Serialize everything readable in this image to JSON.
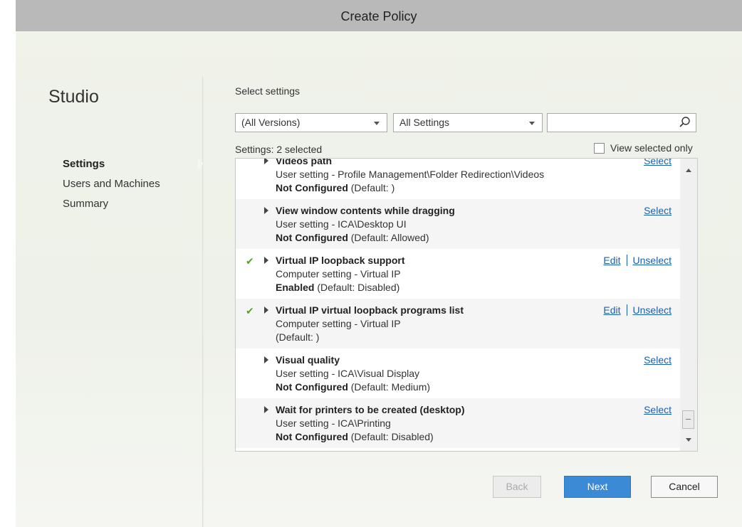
{
  "window": {
    "title": "Create Policy"
  },
  "sidebar": {
    "app_name": "Studio",
    "items": [
      {
        "label": "Settings",
        "active": true
      },
      {
        "label": "Users and Machines",
        "active": false
      },
      {
        "label": "Summary",
        "active": false
      }
    ]
  },
  "main": {
    "heading": "Select settings",
    "version_filter": {
      "value": "(All Versions)"
    },
    "category_filter": {
      "value": "All Settings"
    },
    "search": {
      "value": "",
      "placeholder": ""
    },
    "settings_count": "Settings: 2 selected",
    "view_selected_only": {
      "label": "View selected only",
      "checked": false
    },
    "settings": [
      {
        "name": "Videos path",
        "category": "User setting - Profile Management\\Folder Redirection\\Videos",
        "state": "Not Configured",
        "default": " (Default: )",
        "selected": false,
        "actions": {
          "select": "Select"
        }
      },
      {
        "name": "View window contents while dragging",
        "category": "User setting - ICA\\Desktop UI",
        "state": "Not Configured",
        "default": " (Default: Allowed)",
        "selected": false,
        "actions": {
          "select": "Select"
        }
      },
      {
        "name": "Virtual IP loopback support",
        "category": "Computer setting - Virtual IP",
        "state": "Enabled",
        "default": " (Default: Disabled)",
        "selected": true,
        "actions": {
          "edit": "Edit",
          "unselect": "Unselect"
        }
      },
      {
        "name": "Virtual IP virtual loopback programs list",
        "category": "Computer setting - Virtual IP",
        "state": "",
        "default": " (Default: )",
        "selected": true,
        "actions": {
          "edit": "Edit",
          "unselect": "Unselect"
        }
      },
      {
        "name": "Visual quality",
        "category": "User setting - ICA\\Visual Display",
        "state": "Not Configured",
        "default": " (Default: Medium)",
        "selected": false,
        "actions": {
          "select": "Select"
        }
      },
      {
        "name": "Wait for printers to be created (desktop)",
        "category": "User setting - ICA\\Printing",
        "state": "Not Configured",
        "default": " (Default: Disabled)",
        "selected": false,
        "actions": {
          "select": "Select"
        }
      }
    ]
  },
  "footer": {
    "back": "Back",
    "next": "Next",
    "cancel": "Cancel"
  },
  "colors": {
    "link": "#1a5fb4",
    "primary_button": "#3a8ad6",
    "check": "#5aa02c",
    "titlebar": "#b9b9b9"
  }
}
